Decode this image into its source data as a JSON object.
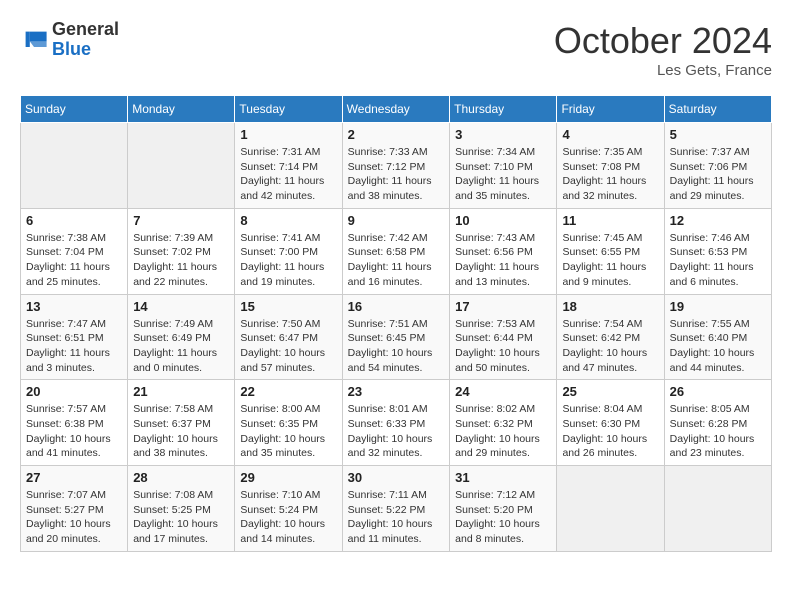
{
  "logo": {
    "general": "General",
    "blue": "Blue"
  },
  "title": "October 2024",
  "location": "Les Gets, France",
  "days_of_week": [
    "Sunday",
    "Monday",
    "Tuesday",
    "Wednesday",
    "Thursday",
    "Friday",
    "Saturday"
  ],
  "weeks": [
    [
      {
        "day": "",
        "sunrise": "",
        "sunset": "",
        "daylight": ""
      },
      {
        "day": "",
        "sunrise": "",
        "sunset": "",
        "daylight": ""
      },
      {
        "day": "1",
        "sunrise": "Sunrise: 7:31 AM",
        "sunset": "Sunset: 7:14 PM",
        "daylight": "Daylight: 11 hours and 42 minutes."
      },
      {
        "day": "2",
        "sunrise": "Sunrise: 7:33 AM",
        "sunset": "Sunset: 7:12 PM",
        "daylight": "Daylight: 11 hours and 38 minutes."
      },
      {
        "day": "3",
        "sunrise": "Sunrise: 7:34 AM",
        "sunset": "Sunset: 7:10 PM",
        "daylight": "Daylight: 11 hours and 35 minutes."
      },
      {
        "day": "4",
        "sunrise": "Sunrise: 7:35 AM",
        "sunset": "Sunset: 7:08 PM",
        "daylight": "Daylight: 11 hours and 32 minutes."
      },
      {
        "day": "5",
        "sunrise": "Sunrise: 7:37 AM",
        "sunset": "Sunset: 7:06 PM",
        "daylight": "Daylight: 11 hours and 29 minutes."
      }
    ],
    [
      {
        "day": "6",
        "sunrise": "Sunrise: 7:38 AM",
        "sunset": "Sunset: 7:04 PM",
        "daylight": "Daylight: 11 hours and 25 minutes."
      },
      {
        "day": "7",
        "sunrise": "Sunrise: 7:39 AM",
        "sunset": "Sunset: 7:02 PM",
        "daylight": "Daylight: 11 hours and 22 minutes."
      },
      {
        "day": "8",
        "sunrise": "Sunrise: 7:41 AM",
        "sunset": "Sunset: 7:00 PM",
        "daylight": "Daylight: 11 hours and 19 minutes."
      },
      {
        "day": "9",
        "sunrise": "Sunrise: 7:42 AM",
        "sunset": "Sunset: 6:58 PM",
        "daylight": "Daylight: 11 hours and 16 minutes."
      },
      {
        "day": "10",
        "sunrise": "Sunrise: 7:43 AM",
        "sunset": "Sunset: 6:56 PM",
        "daylight": "Daylight: 11 hours and 13 minutes."
      },
      {
        "day": "11",
        "sunrise": "Sunrise: 7:45 AM",
        "sunset": "Sunset: 6:55 PM",
        "daylight": "Daylight: 11 hours and 9 minutes."
      },
      {
        "day": "12",
        "sunrise": "Sunrise: 7:46 AM",
        "sunset": "Sunset: 6:53 PM",
        "daylight": "Daylight: 11 hours and 6 minutes."
      }
    ],
    [
      {
        "day": "13",
        "sunrise": "Sunrise: 7:47 AM",
        "sunset": "Sunset: 6:51 PM",
        "daylight": "Daylight: 11 hours and 3 minutes."
      },
      {
        "day": "14",
        "sunrise": "Sunrise: 7:49 AM",
        "sunset": "Sunset: 6:49 PM",
        "daylight": "Daylight: 11 hours and 0 minutes."
      },
      {
        "day": "15",
        "sunrise": "Sunrise: 7:50 AM",
        "sunset": "Sunset: 6:47 PM",
        "daylight": "Daylight: 10 hours and 57 minutes."
      },
      {
        "day": "16",
        "sunrise": "Sunrise: 7:51 AM",
        "sunset": "Sunset: 6:45 PM",
        "daylight": "Daylight: 10 hours and 54 minutes."
      },
      {
        "day": "17",
        "sunrise": "Sunrise: 7:53 AM",
        "sunset": "Sunset: 6:44 PM",
        "daylight": "Daylight: 10 hours and 50 minutes."
      },
      {
        "day": "18",
        "sunrise": "Sunrise: 7:54 AM",
        "sunset": "Sunset: 6:42 PM",
        "daylight": "Daylight: 10 hours and 47 minutes."
      },
      {
        "day": "19",
        "sunrise": "Sunrise: 7:55 AM",
        "sunset": "Sunset: 6:40 PM",
        "daylight": "Daylight: 10 hours and 44 minutes."
      }
    ],
    [
      {
        "day": "20",
        "sunrise": "Sunrise: 7:57 AM",
        "sunset": "Sunset: 6:38 PM",
        "daylight": "Daylight: 10 hours and 41 minutes."
      },
      {
        "day": "21",
        "sunrise": "Sunrise: 7:58 AM",
        "sunset": "Sunset: 6:37 PM",
        "daylight": "Daylight: 10 hours and 38 minutes."
      },
      {
        "day": "22",
        "sunrise": "Sunrise: 8:00 AM",
        "sunset": "Sunset: 6:35 PM",
        "daylight": "Daylight: 10 hours and 35 minutes."
      },
      {
        "day": "23",
        "sunrise": "Sunrise: 8:01 AM",
        "sunset": "Sunset: 6:33 PM",
        "daylight": "Daylight: 10 hours and 32 minutes."
      },
      {
        "day": "24",
        "sunrise": "Sunrise: 8:02 AM",
        "sunset": "Sunset: 6:32 PM",
        "daylight": "Daylight: 10 hours and 29 minutes."
      },
      {
        "day": "25",
        "sunrise": "Sunrise: 8:04 AM",
        "sunset": "Sunset: 6:30 PM",
        "daylight": "Daylight: 10 hours and 26 minutes."
      },
      {
        "day": "26",
        "sunrise": "Sunrise: 8:05 AM",
        "sunset": "Sunset: 6:28 PM",
        "daylight": "Daylight: 10 hours and 23 minutes."
      }
    ],
    [
      {
        "day": "27",
        "sunrise": "Sunrise: 7:07 AM",
        "sunset": "Sunset: 5:27 PM",
        "daylight": "Daylight: 10 hours and 20 minutes."
      },
      {
        "day": "28",
        "sunrise": "Sunrise: 7:08 AM",
        "sunset": "Sunset: 5:25 PM",
        "daylight": "Daylight: 10 hours and 17 minutes."
      },
      {
        "day": "29",
        "sunrise": "Sunrise: 7:10 AM",
        "sunset": "Sunset: 5:24 PM",
        "daylight": "Daylight: 10 hours and 14 minutes."
      },
      {
        "day": "30",
        "sunrise": "Sunrise: 7:11 AM",
        "sunset": "Sunset: 5:22 PM",
        "daylight": "Daylight: 10 hours and 11 minutes."
      },
      {
        "day": "31",
        "sunrise": "Sunrise: 7:12 AM",
        "sunset": "Sunset: 5:20 PM",
        "daylight": "Daylight: 10 hours and 8 minutes."
      },
      {
        "day": "",
        "sunrise": "",
        "sunset": "",
        "daylight": ""
      },
      {
        "day": "",
        "sunrise": "",
        "sunset": "",
        "daylight": ""
      }
    ]
  ]
}
